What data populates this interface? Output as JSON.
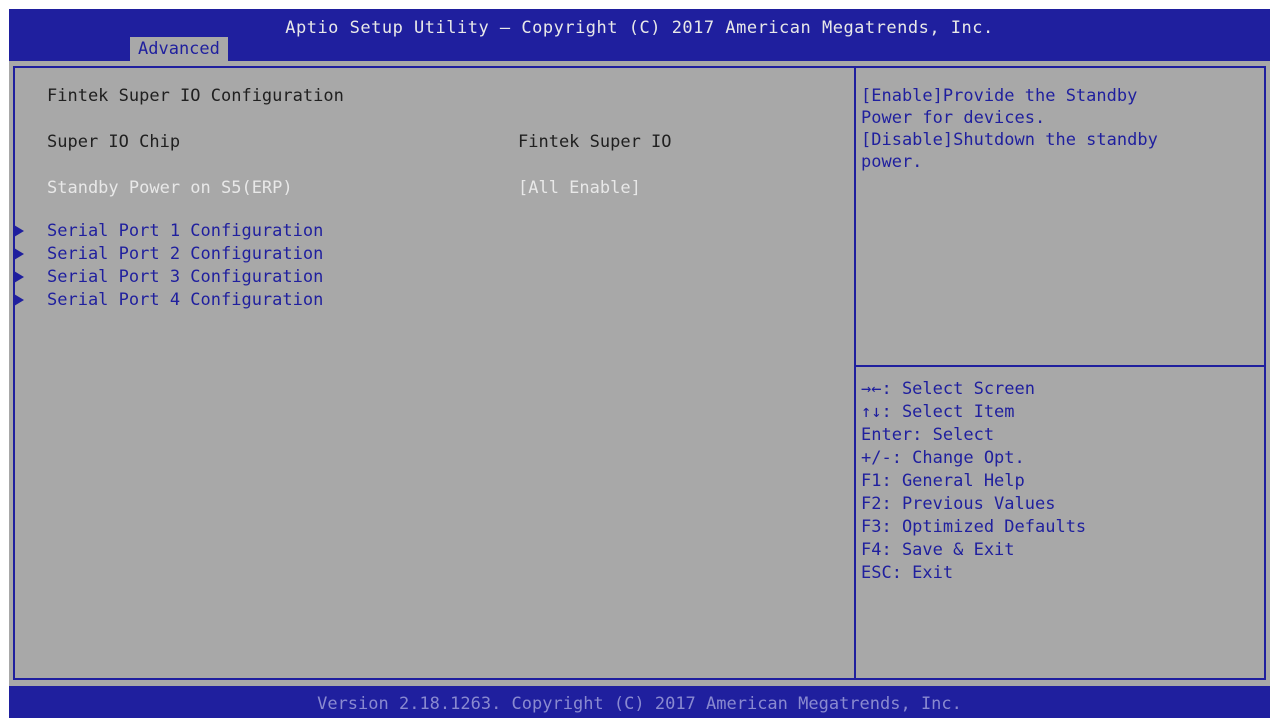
{
  "header": {
    "title": "Aptio Setup Utility – Copyright (C) 2017 American Megatrends, Inc.",
    "active_tab": "Advanced"
  },
  "main": {
    "heading": "Fintek Super IO Configuration",
    "info_row": {
      "label": "Super IO Chip",
      "value": "Fintek Super IO"
    },
    "setting_row": {
      "label": "Standby Power on S5(ERP)",
      "value": "[All Enable]"
    },
    "submenus": [
      "Serial Port 1 Configuration",
      "Serial Port 2 Configuration",
      "Serial Port 3 Configuration",
      "Serial Port 4 Configuration"
    ]
  },
  "help_panel": {
    "lines": [
      "[Enable]Provide the Standby",
      "Power for devices.",
      "[Disable]Shutdown the standby",
      "power."
    ]
  },
  "key_legend": [
    "→←: Select Screen",
    "↑↓: Select Item",
    "Enter: Select",
    "+/-: Change Opt.",
    "F1: General Help",
    "F2: Previous Values",
    "F3: Optimized Defaults",
    "F4: Save & Exit",
    "ESC: Exit"
  ],
  "footer": {
    "version": "Version 2.18.1263. Copyright (C) 2017 American Megatrends, Inc."
  },
  "colors": {
    "blue": "#1f1f9e",
    "panel_gray": "#a8a8a8",
    "highlight_white": "#e8e8e8"
  }
}
